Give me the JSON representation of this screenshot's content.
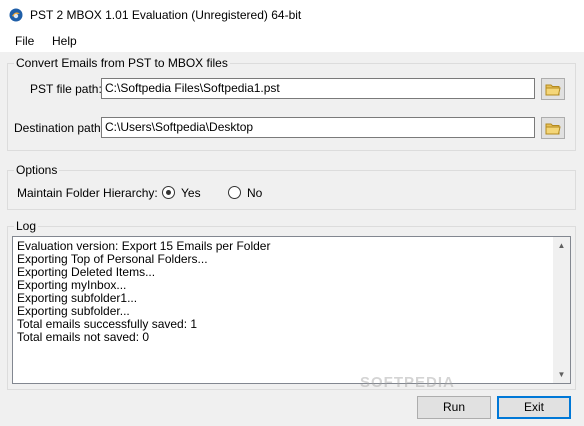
{
  "window": {
    "title": "PST 2 MBOX 1.01 Evaluation (Unregistered) 64-bit",
    "icon": "thunderbird-app-icon"
  },
  "menu": {
    "file": "File",
    "help": "Help"
  },
  "convert_group": {
    "title": "Convert Emails from PST to MBOX files",
    "pst_label": "PST file path:",
    "pst_value": "C:\\Softpedia Files\\Softpedia1.pst",
    "dest_label": "Destination path:",
    "dest_value": "C:\\Users\\Softpedia\\Desktop"
  },
  "options_group": {
    "title": "Options",
    "hierarchy_label": "Maintain Folder Hierarchy:",
    "yes_label": "Yes",
    "no_label": "No",
    "selected": "Yes"
  },
  "log_group": {
    "title": "Log",
    "lines": [
      "Evaluation version: Export 15 Emails per Folder",
      "Exporting Top of Personal Folders...",
      "Exporting Deleted Items...",
      "Exporting myInbox...",
      "Exporting subfolder1...",
      "Exporting subfolder...",
      "Total emails successfully saved: 1",
      "Total emails not saved: 0"
    ]
  },
  "buttons": {
    "run": "Run",
    "exit": "Exit"
  },
  "watermark": "SOFTPEDIA",
  "colors": {
    "window_bg": "#f0f0f0",
    "accent": "#0078d7",
    "folder_icon": "#e8c15a"
  }
}
